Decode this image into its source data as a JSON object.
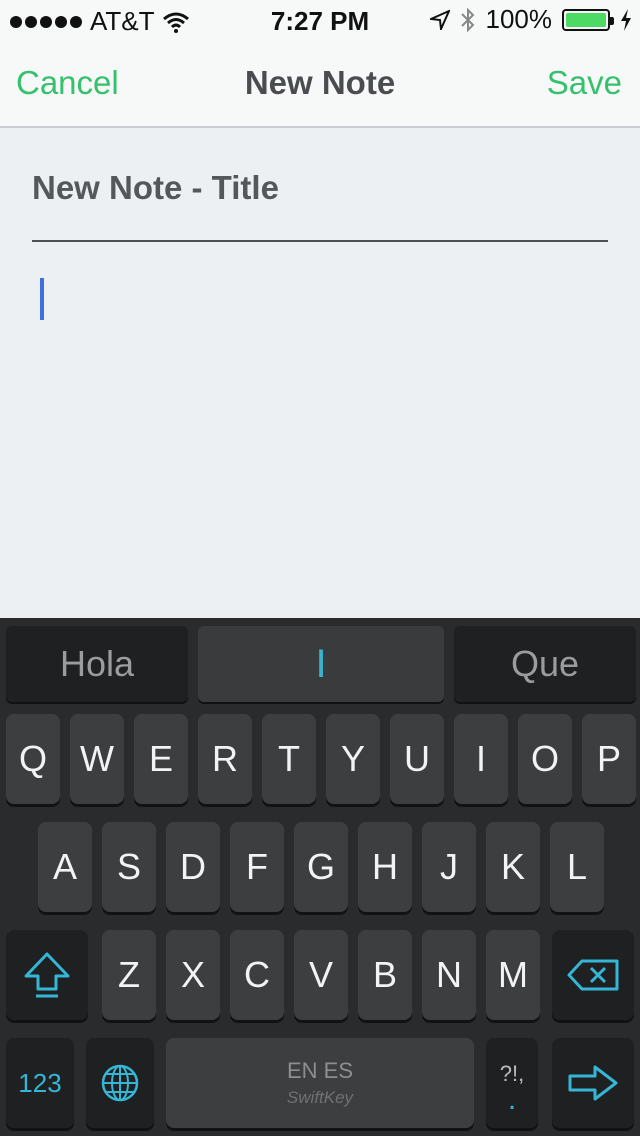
{
  "status": {
    "carrier": "AT&T",
    "time": "7:27 PM",
    "battery": "100%",
    "signal_icon": "signal-dots-icon",
    "wifi_icon": "wifi-icon",
    "location_icon": "location-arrow-icon",
    "bluetooth_icon": "bluetooth-icon",
    "battery_icon": "battery-icon",
    "charging_icon": "charging-bolt-icon"
  },
  "nav": {
    "cancel": "Cancel",
    "title": "New Note",
    "save": "Save"
  },
  "note": {
    "title_placeholder": "New Note - Title",
    "body": ""
  },
  "keyboard": {
    "suggestions": [
      "Hola",
      "I",
      "Que"
    ],
    "row1": [
      "Q",
      "W",
      "E",
      "R",
      "T",
      "Y",
      "U",
      "I",
      "O",
      "P"
    ],
    "row2": [
      "A",
      "S",
      "D",
      "F",
      "G",
      "H",
      "J",
      "K",
      "L"
    ],
    "row3": [
      "Z",
      "X",
      "C",
      "V",
      "B",
      "N",
      "M"
    ],
    "numbers_key": "123",
    "space_language": "EN ES",
    "space_brand": "SwiftKey",
    "punct_top": "?!,",
    "punct_bottom": ".",
    "accent_color": "#35b6d6",
    "save_color": "#35c16e"
  }
}
